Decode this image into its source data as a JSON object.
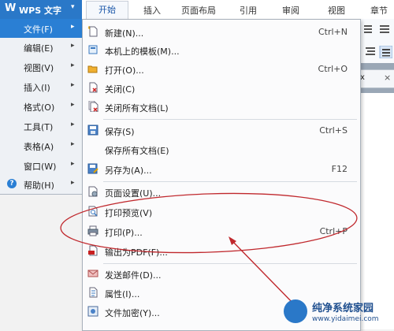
{
  "app": {
    "logo_glyph": "W",
    "title": "WPS 文字",
    "arrow": "▾"
  },
  "tabs": [
    {
      "label": "开始"
    },
    {
      "label": "插入"
    },
    {
      "label": "页面布局"
    },
    {
      "label": "引用"
    },
    {
      "label": "审阅"
    },
    {
      "label": "视图"
    },
    {
      "label": "章节"
    }
  ],
  "ribbon": {
    "fragment": "x",
    "close": "×"
  },
  "left_menu": {
    "items": [
      {
        "label": "文件(F)",
        "chev": "▸"
      },
      {
        "label": "编辑(E)",
        "chev": "▸"
      },
      {
        "label": "视图(V)",
        "chev": "▸"
      },
      {
        "label": "插入(I)",
        "chev": "▸"
      },
      {
        "label": "格式(O)",
        "chev": "▸"
      },
      {
        "label": "工具(T)",
        "chev": "▸"
      },
      {
        "label": "表格(A)",
        "chev": "▸"
      },
      {
        "label": "窗口(W)",
        "chev": "▸"
      },
      {
        "label": "帮助(H)",
        "chev": "▸",
        "icon": "?"
      }
    ]
  },
  "file_menu": {
    "items": [
      {
        "label": "新建(N)...",
        "shortcut": "Ctrl+N",
        "icon": "new-doc-icon"
      },
      {
        "label": "本机上的模板(M)...",
        "shortcut": "",
        "icon": "template-icon"
      },
      {
        "label": "打开(O)...",
        "shortcut": "Ctrl+O",
        "icon": "folder-open-icon"
      },
      {
        "label": "关闭(C)",
        "shortcut": "",
        "icon": "close-doc-icon"
      },
      {
        "label": "关闭所有文档(L)",
        "shortcut": "",
        "icon": "close-all-icon"
      },
      {
        "label": "保存(S)",
        "shortcut": "Ctrl+S",
        "icon": "save-icon"
      },
      {
        "label": "保存所有文档(E)",
        "shortcut": "",
        "icon": ""
      },
      {
        "label": "另存为(A)...",
        "shortcut": "F12",
        "icon": "save-as-icon"
      },
      {
        "label": "页面设置(U)...",
        "shortcut": "",
        "icon": "page-setup-icon"
      },
      {
        "label": "打印预览(V)",
        "shortcut": "",
        "icon": "print-preview-icon"
      },
      {
        "label": "打印(P)...",
        "shortcut": "Ctrl+P",
        "icon": "printer-icon"
      },
      {
        "label": "输出为PDF(F)...",
        "shortcut": "",
        "icon": "pdf-icon"
      },
      {
        "label": "发送邮件(D)...",
        "shortcut": "",
        "icon": "mail-icon"
      },
      {
        "label": "属性(I)...",
        "shortcut": "",
        "icon": "properties-icon"
      },
      {
        "label": "文件加密(Y)...",
        "shortcut": "",
        "icon": "encrypt-icon"
      }
    ]
  },
  "watermark": {
    "text": "纯净系统家园",
    "url": "www.yidaimei.com"
  },
  "colors": {
    "accent": "#2a7fd4",
    "annotation": "#c0282d"
  }
}
